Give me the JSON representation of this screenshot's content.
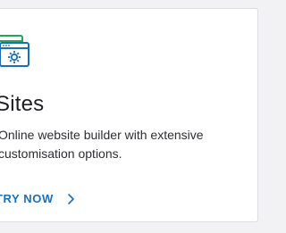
{
  "card": {
    "title": "Sites",
    "description": "Online website builder with extensive customisation options.",
    "icon": "browser-gear-icon",
    "cta": {
      "label": "TRY NOW",
      "icon": "chevron-right-icon"
    }
  },
  "colors": {
    "accent": "#1a6fb8",
    "icon_green": "#2aa35a",
    "title_text": "#1f1f23",
    "body_text": "#2d2d33"
  }
}
